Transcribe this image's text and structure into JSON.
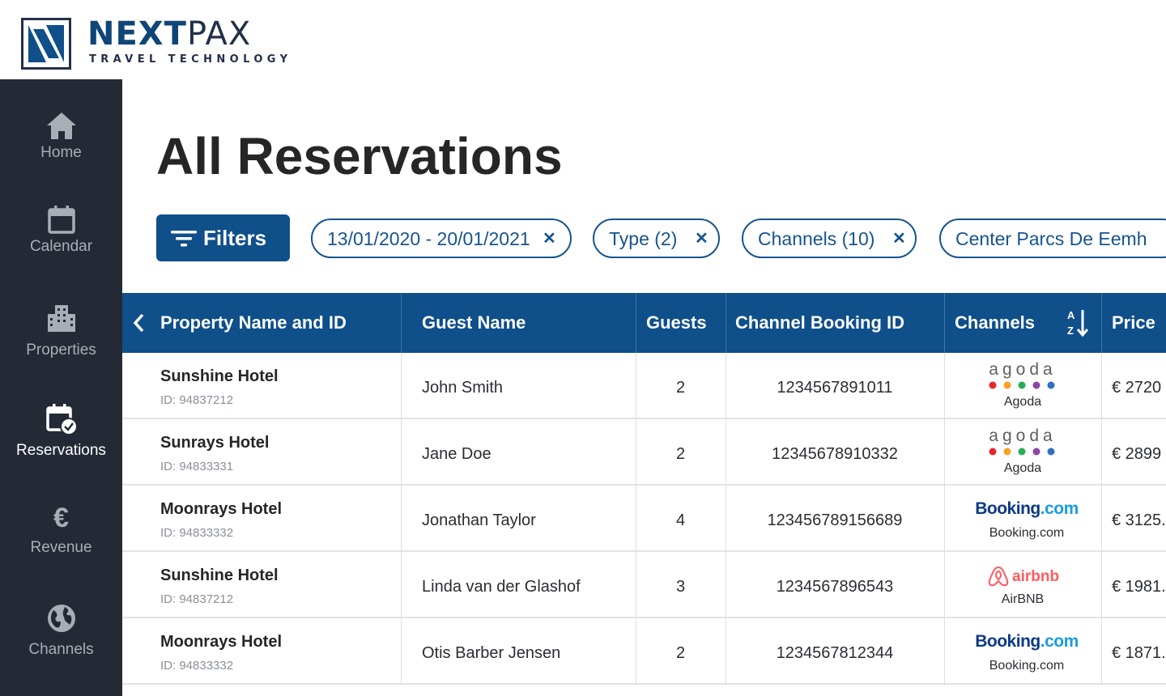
{
  "brand": {
    "name_bold": "NEXT",
    "name_light": "PAX",
    "tagline": "TRAVEL TECHNOLOGY"
  },
  "sidebar": {
    "items": [
      {
        "label": "Home",
        "icon": "home-icon",
        "active": false
      },
      {
        "label": "Calendar",
        "icon": "calendar-icon",
        "active": false
      },
      {
        "label": "Properties",
        "icon": "building-icon",
        "active": false
      },
      {
        "label": "Reservations",
        "icon": "calendar-check-icon",
        "active": true
      },
      {
        "label": "Revenue",
        "icon": "euro-icon",
        "active": false
      },
      {
        "label": "Channels",
        "icon": "globe-icon",
        "active": false
      }
    ]
  },
  "page": {
    "title": "All Reservations"
  },
  "filters": {
    "button_label": "Filters",
    "chips": [
      {
        "label": "13/01/2020 - 20/01/2021",
        "removable": true
      },
      {
        "label": "Type (2)",
        "removable": true
      },
      {
        "label": "Channels (10)",
        "removable": true
      },
      {
        "label": "Center Parcs De Eemh",
        "removable": false
      }
    ]
  },
  "table": {
    "columns": [
      "Property Name and ID",
      "Guest Name",
      "Guests",
      "Channel Booking ID",
      "Channels",
      "Price"
    ],
    "sort_icon": "sort-az-icon",
    "rows": [
      {
        "property": "Sunshine Hotel",
        "property_id": "ID: 94837212",
        "guest": "John Smith",
        "guests": "2",
        "booking_id": "1234567891011",
        "channel": "agoda",
        "channel_name": "Agoda",
        "price": "€ 2720"
      },
      {
        "property": "Sunrays Hotel",
        "property_id": "ID: 94833331",
        "guest": "Jane Doe",
        "guests": "2",
        "booking_id": "12345678910332",
        "channel": "agoda",
        "channel_name": "Agoda",
        "price": "€ 2899"
      },
      {
        "property": "Moonrays Hotel",
        "property_id": "ID: 94833332",
        "guest": "Jonathan Taylor",
        "guests": "4",
        "booking_id": "123456789156689",
        "channel": "booking",
        "channel_name": "Booking.com",
        "price": "€ 3125."
      },
      {
        "property": "Sunshine Hotel",
        "property_id": "ID: 94837212",
        "guest": "Linda van der Glashof",
        "guests": "3",
        "booking_id": "1234567896543",
        "channel": "airbnb",
        "channel_name": "AirBNB",
        "price": "€ 1981."
      },
      {
        "property": "Moonrays Hotel",
        "property_id": "ID: 94833332",
        "guest": "Otis Barber Jensen",
        "guests": "2",
        "booking_id": "1234567812344",
        "channel": "booking",
        "channel_name": "Booking.com",
        "price": "€ 1871."
      }
    ]
  },
  "logos": {
    "agoda_word": "agoda",
    "booking_word_a": "Booking",
    "booking_word_b": ".com",
    "airbnb_word": "airbnb"
  },
  "colors": {
    "brand_blue": "#0f4f8a",
    "sidebar_bg": "#232a36",
    "airbnb": "#ff5a5f",
    "booking_dark": "#0d3a84",
    "booking_light": "#1a9be0",
    "agoda_dots": [
      "#e8262c",
      "#f7a226",
      "#27ad56",
      "#8c44a4",
      "#2f6fc2"
    ]
  }
}
